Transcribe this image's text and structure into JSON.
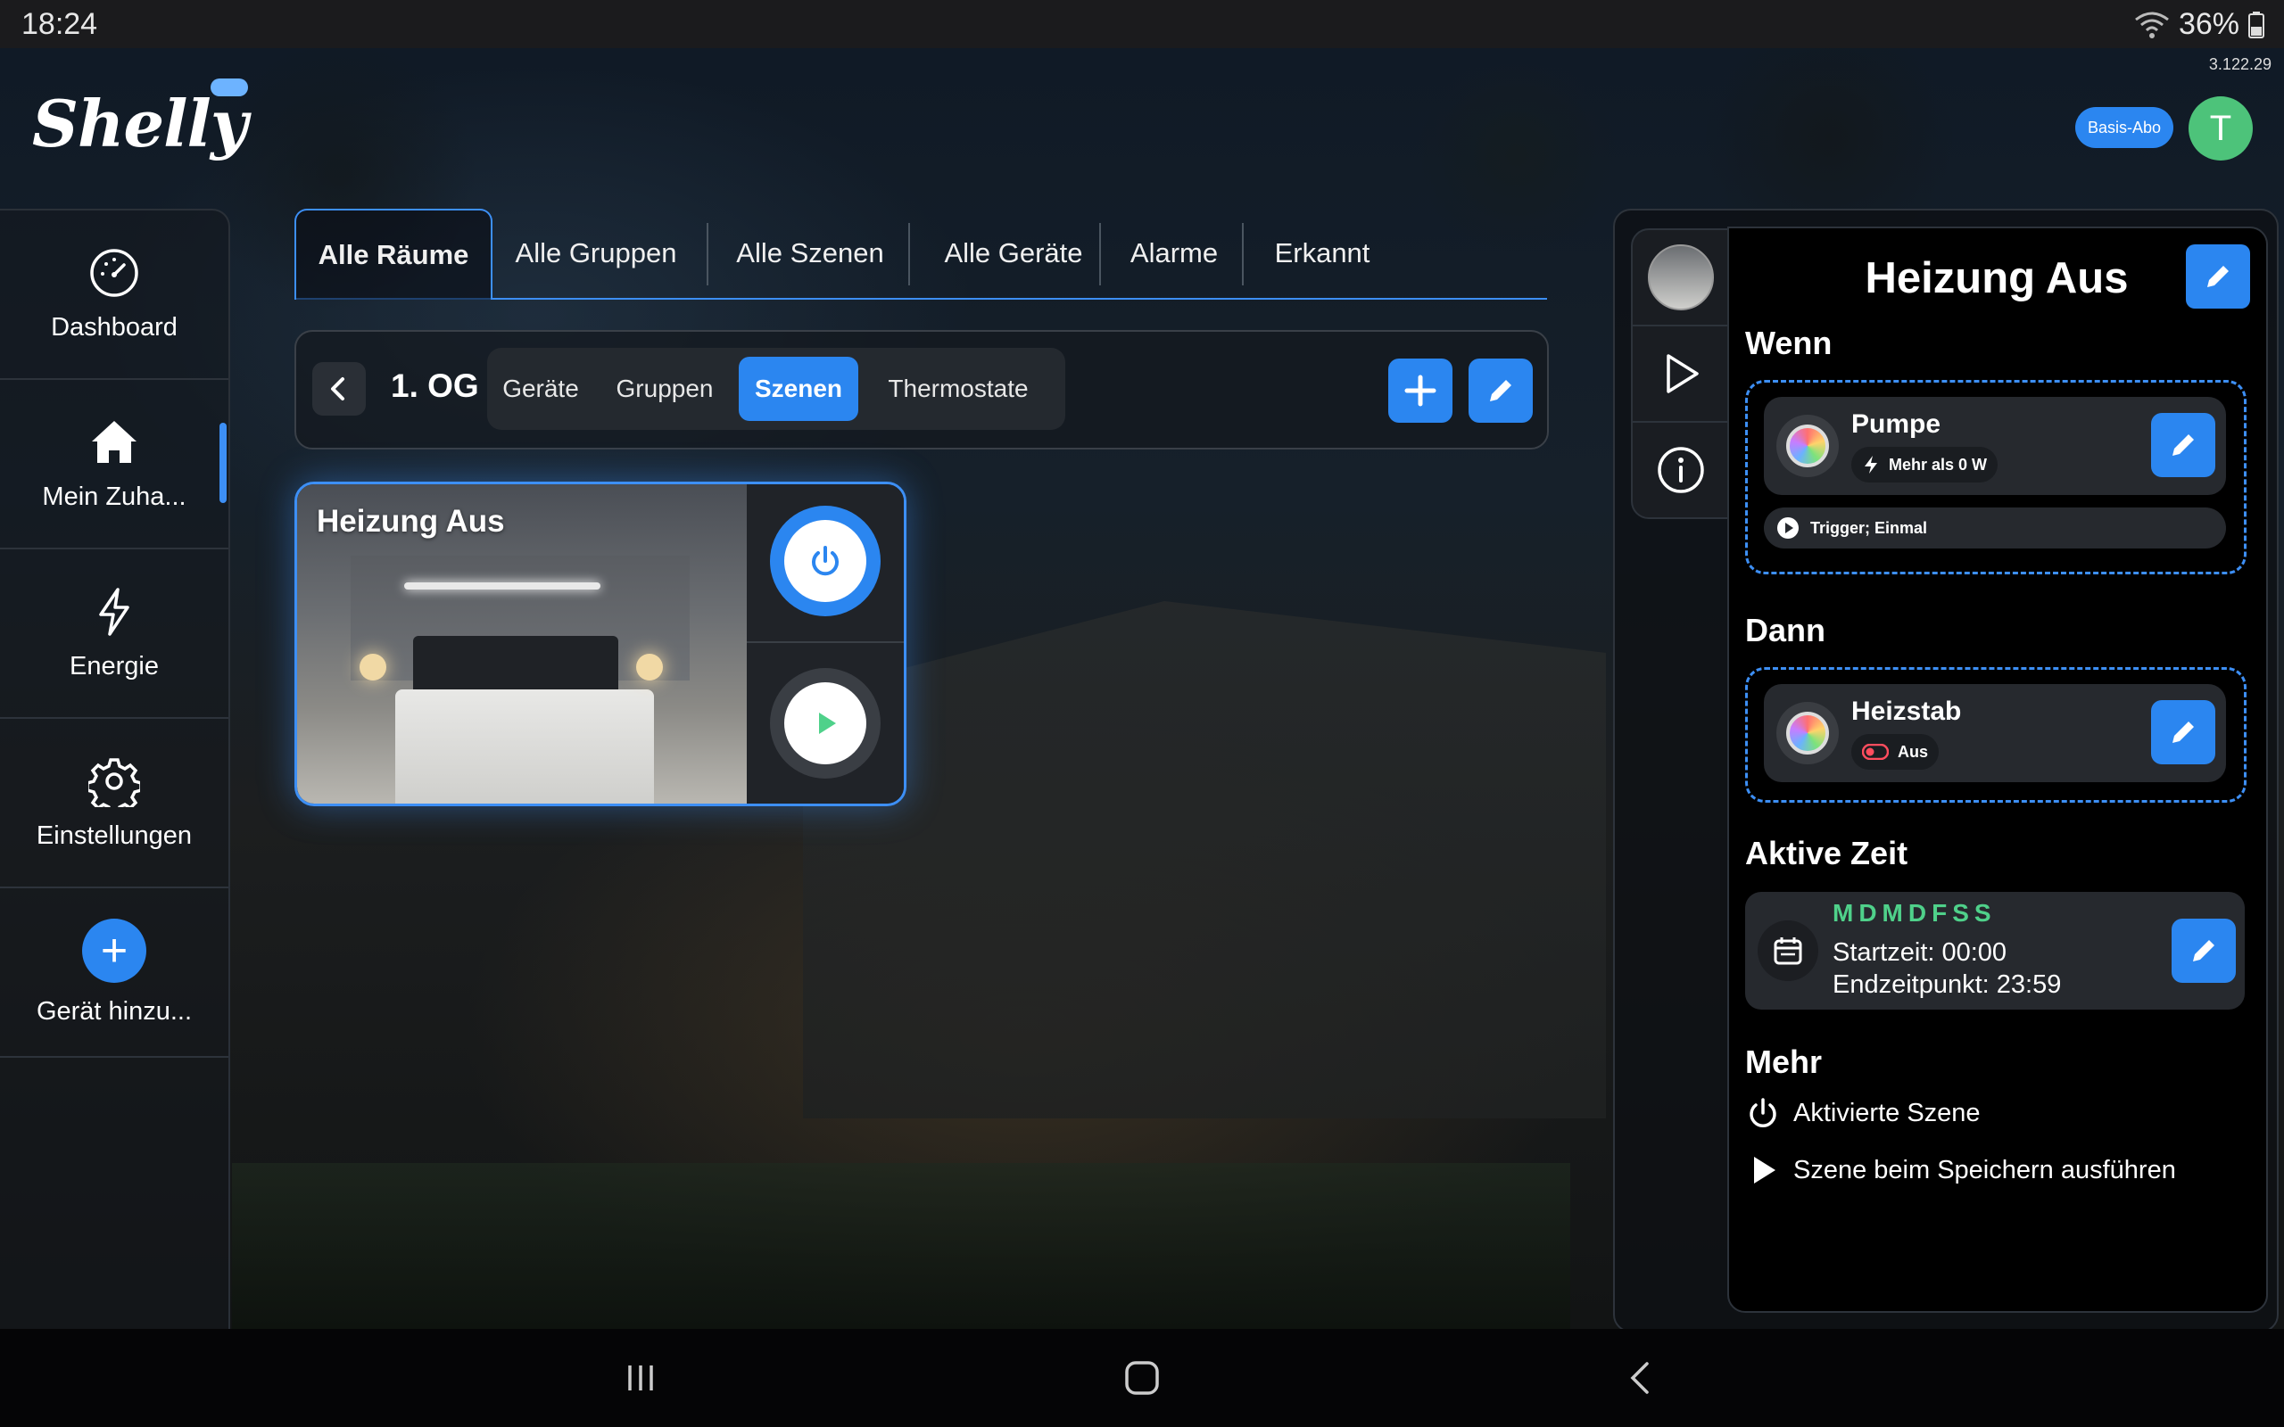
{
  "status": {
    "time": "18:24",
    "battery": "36%"
  },
  "app": {
    "version": "3.122.29",
    "logo": "Shelly",
    "plan_badge": "Basis-Abo",
    "avatar_initial": "T"
  },
  "sidebar": {
    "items": [
      {
        "label": "Dashboard",
        "icon": "gauge-icon"
      },
      {
        "label": "Mein Zuha...",
        "icon": "home-icon"
      },
      {
        "label": "Energie",
        "icon": "bolt-icon"
      },
      {
        "label": "Einstellungen",
        "icon": "gear-icon"
      },
      {
        "label": "Gerät hinzu...",
        "icon": "plus-icon"
      }
    ]
  },
  "tabs": [
    "Alle Räume",
    "Alle Gruppen",
    "Alle Szenen",
    "Alle Geräte",
    "Alarme",
    "Erkannt"
  ],
  "room": {
    "title": "1. OG",
    "subtabs": [
      "Geräte",
      "Gruppen",
      "Szenen",
      "Thermostate"
    ],
    "active_subtab": "Szenen"
  },
  "scene_card": {
    "title": "Heizung Aus"
  },
  "panel": {
    "title": "Heizung Aus",
    "when_heading": "Wenn",
    "when_device": {
      "name": "Pumpe",
      "condition": "Mehr als 0 W"
    },
    "trigger": "Trigger; Einmal",
    "then_heading": "Dann",
    "then_device": {
      "name": "Heizstab",
      "state": "Aus"
    },
    "active_time_heading": "Aktive Zeit",
    "days": "MDMDFSS",
    "start": "Startzeit: 00:00",
    "end": "Endzeitpunkt: 23:59",
    "more_heading": "Mehr",
    "more_items": [
      "Aktivierte Szene",
      "Szene beim Speichern ausführen"
    ]
  },
  "colors": {
    "accent": "#2b86f0",
    "days_green": "#4fd18a",
    "avatar_green": "#4dc37a"
  }
}
